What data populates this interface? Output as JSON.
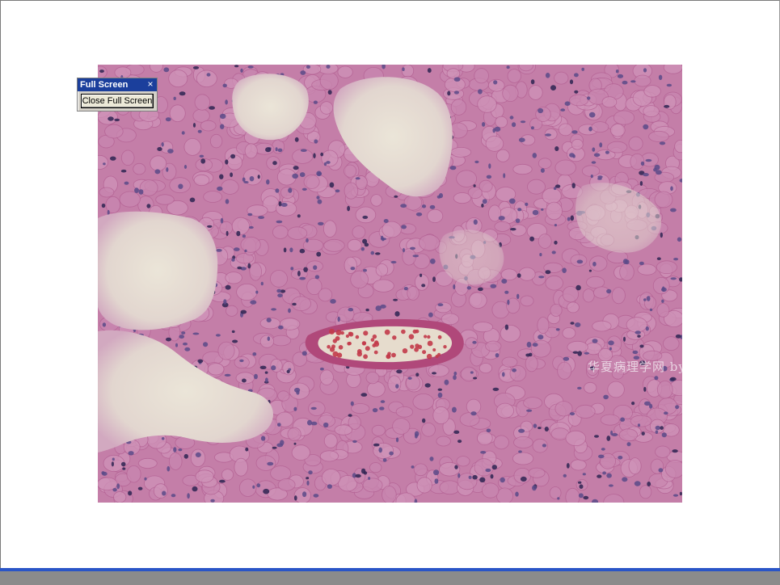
{
  "toolbar": {
    "title": "Full Screen",
    "close_glyph": "×",
    "close_button_label": "Close Full Screen",
    "icon": "close-icon"
  },
  "image": {
    "watermark": "华夏病理学网 by hyfhql",
    "colors": {
      "tissue": "#c27ba6",
      "lumen": "#e8e0d2",
      "nucleus": "#4a3a78",
      "rbc": "#c23a4a"
    }
  },
  "colors": {
    "titlebar": "#1b3f9c",
    "bottom_accent": "#2a55c7",
    "bottom_bar": "#8b8b8b"
  }
}
